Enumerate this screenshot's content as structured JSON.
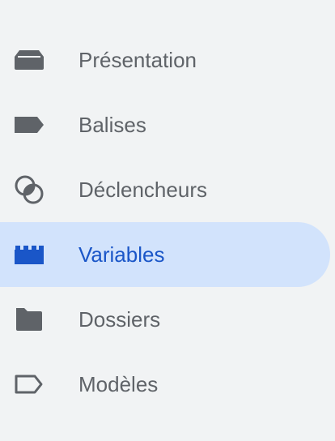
{
  "sidebar": {
    "items": [
      {
        "label": "Présentation",
        "icon": "overview-icon",
        "active": false
      },
      {
        "label": "Balises",
        "icon": "tag-icon",
        "active": false
      },
      {
        "label": "Déclencheurs",
        "icon": "trigger-icon",
        "active": false
      },
      {
        "label": "Variables",
        "icon": "variables-icon",
        "active": true
      },
      {
        "label": "Dossiers",
        "icon": "folder-icon",
        "active": false
      },
      {
        "label": "Modèles",
        "icon": "template-icon",
        "active": false
      }
    ]
  },
  "colors": {
    "background": "#f1f3f4",
    "text": "#5f6368",
    "icon": "#5f6368",
    "active_background": "#d2e3fc",
    "active_text": "#1a56c8"
  }
}
